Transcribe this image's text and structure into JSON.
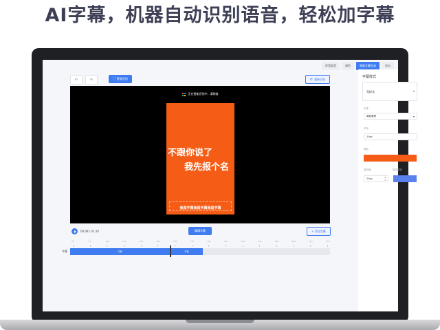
{
  "headline": "AI字幕，机器自动识别语音，轻松加字幕",
  "tabs": [
    "声音配音",
    "调色",
    "智能字幕生成",
    "导出"
  ],
  "toolbar": {
    "undo": "↶",
    "redo": "↷",
    "smart_cut": "智能识别",
    "reset": "重新识别"
  },
  "video": {
    "recognizing_text": "正在智能识别中，请稍候",
    "caption_line1": "不跟你说了",
    "caption_line2": "我先报个名",
    "subtitle_text": "我是字幕我是字幕我是字幕"
  },
  "playback": {
    "time": "00:08 / 01:20",
    "edit_caption": "编辑字幕",
    "add_caption": "+ 添加字幕"
  },
  "timeline": {
    "track_label": "字幕",
    "ticks": [
      "0s",
      "5s",
      "10s",
      "15s",
      "20s",
      "25s",
      "30s",
      "35s",
      "40s",
      "45s",
      "50s",
      "55s",
      "60s",
      "65s",
      "70s",
      "75s"
    ],
    "segments": [
      "字幕",
      "字幕"
    ]
  },
  "panel": {
    "title": "字幕样式",
    "style_value": "无样式",
    "font_label": "字体",
    "font_value": "微软雅黑",
    "size_label": "字号",
    "size_value": "20px",
    "color_label": "颜色",
    "stroke_label": "描边值",
    "stroke_color_label": "描边颜色",
    "stroke_value": "20px",
    "colors": {
      "text_color": "#f55d16",
      "stroke_color": "#5b82ec"
    }
  },
  "colors": {
    "accent": "#3f7cf0",
    "video_bg": "#f55d16"
  }
}
